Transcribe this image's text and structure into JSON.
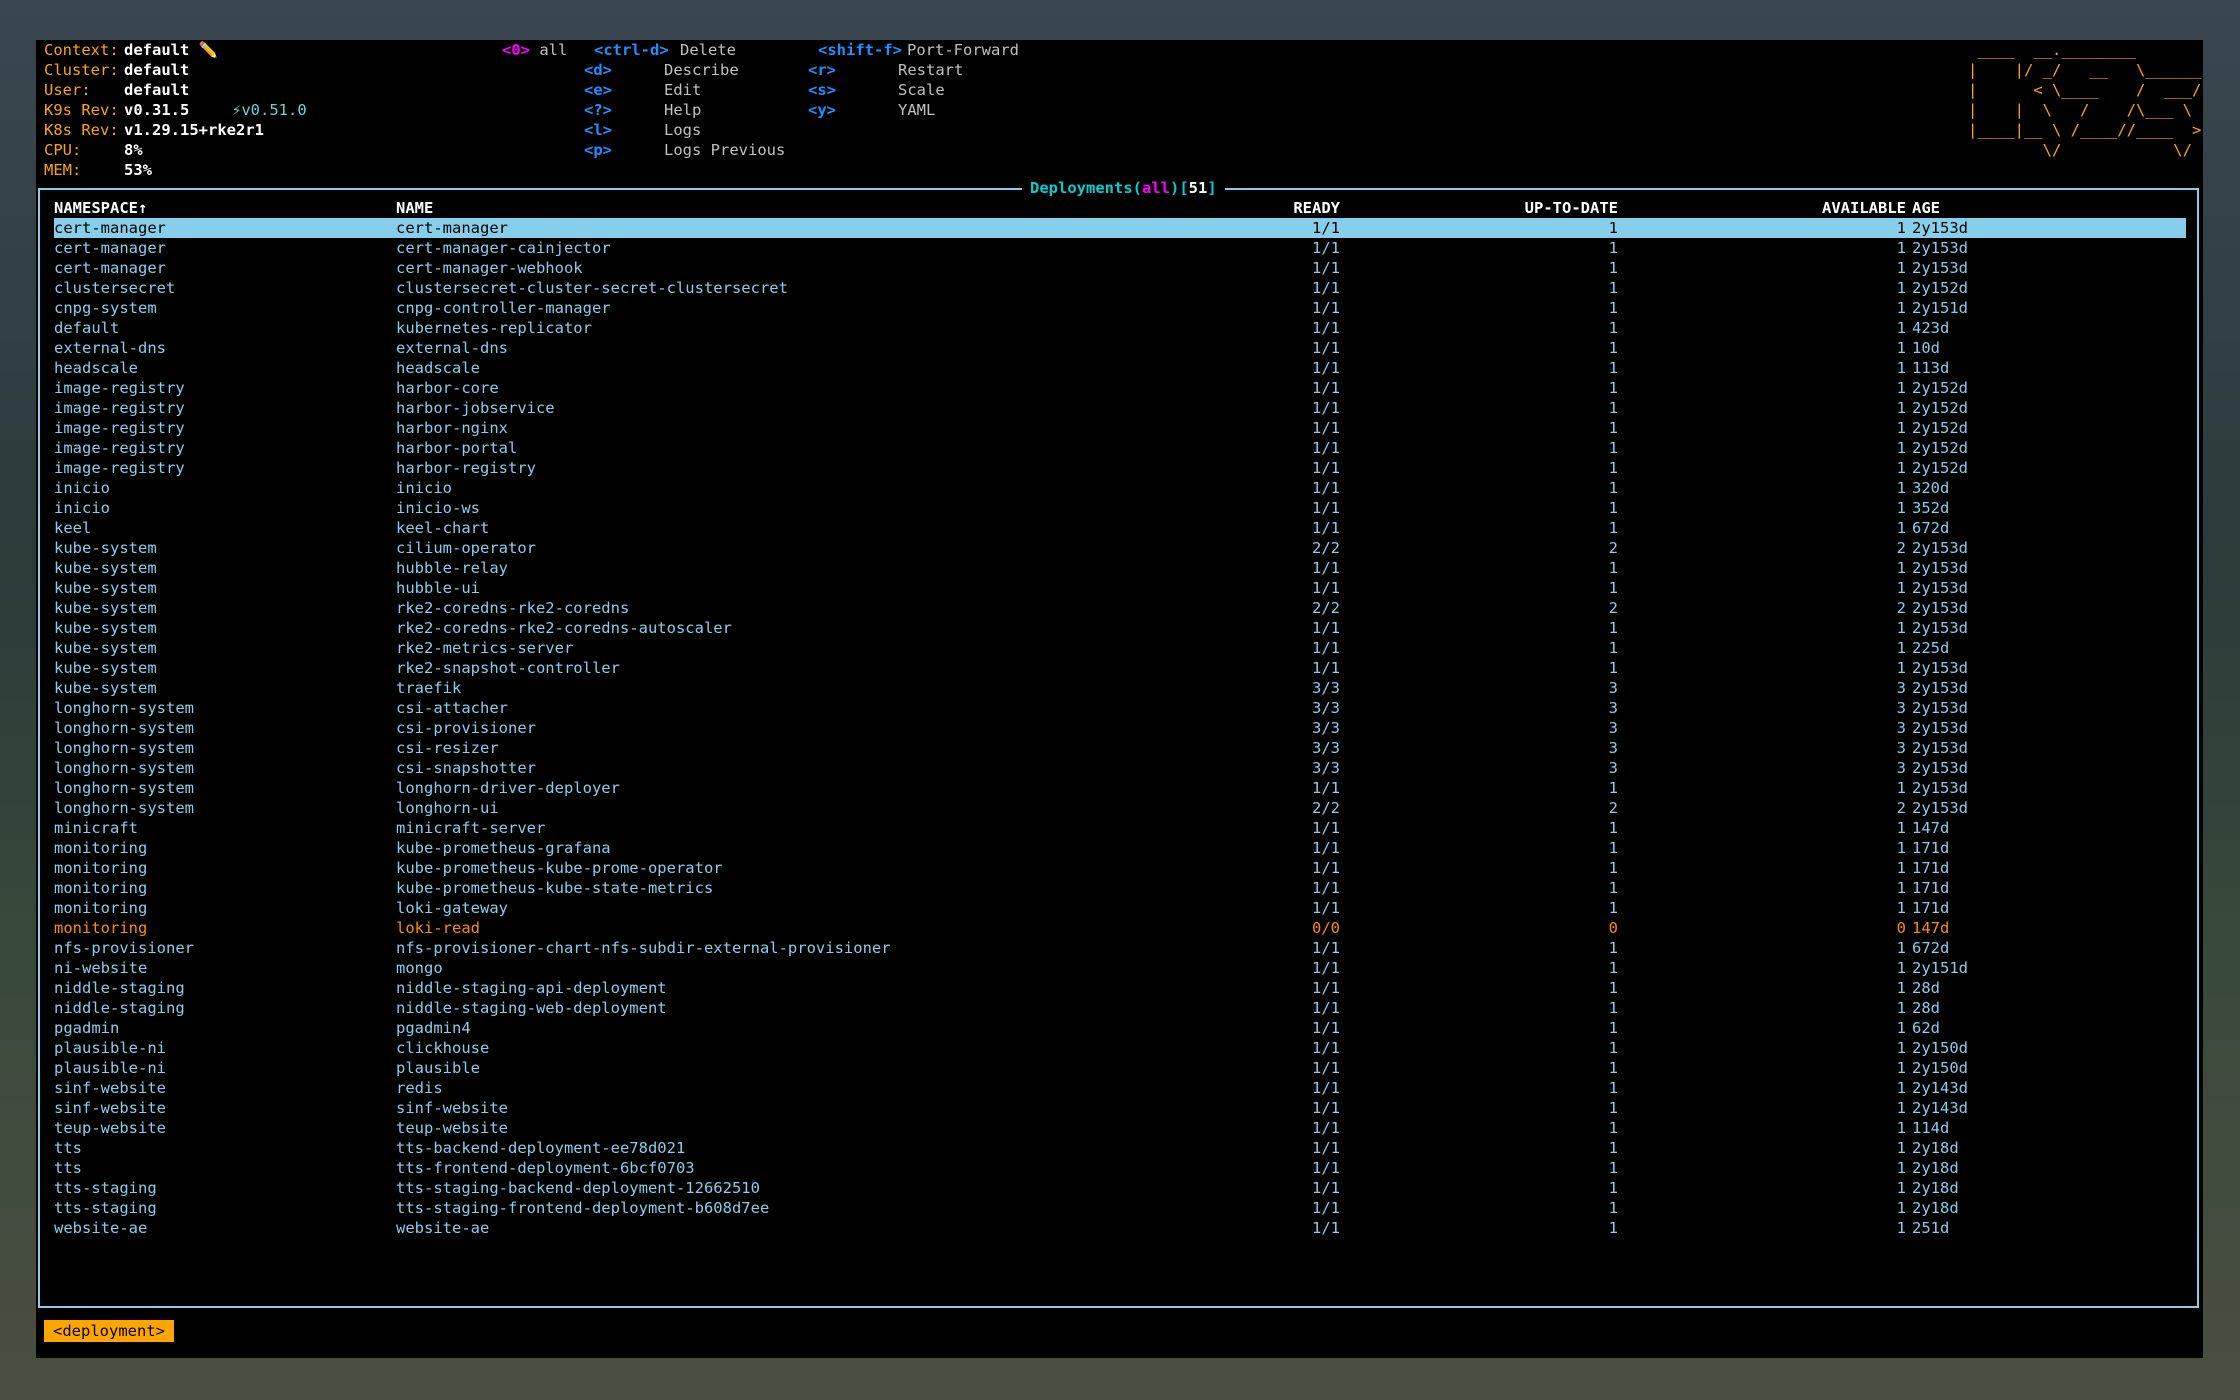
{
  "info": [
    {
      "label": "Context:",
      "value": "default ✏️"
    },
    {
      "label": "Cluster:",
      "value": "default"
    },
    {
      "label": "User:",
      "value": "default"
    },
    {
      "label": "K9s Rev:",
      "value": "v0.31.5",
      "extra": "⚡v0.51.0"
    },
    {
      "label": "K8s Rev:",
      "value": "v1.29.15+rke2r1"
    },
    {
      "label": "CPU:",
      "value": "8%"
    },
    {
      "label": "MEM:",
      "value": "53%"
    }
  ],
  "namespace_hotkey": {
    "key": "<0>",
    "label": "all"
  },
  "hotkeys": [
    {
      "key": "<ctrl-d>",
      "label": "Delete"
    },
    {
      "key": "<d>",
      "label": "Describe"
    },
    {
      "key": "<e>",
      "label": "Edit"
    },
    {
      "key": "<?>",
      "label": "Help"
    },
    {
      "key": "<l>",
      "label": "Logs"
    },
    {
      "key": "<p>",
      "label": "Logs Previous"
    },
    {
      "key": "<shift-f>",
      "label": "Port-Forward"
    },
    {
      "key": "<r>",
      "label": "Restart"
    },
    {
      "key": "<s>",
      "label": "Scale"
    },
    {
      "key": "<y>",
      "label": "YAML"
    }
  ],
  "logo": " ____  __.________       \n|    |/ _/   __   \\______\n|      < \\____    /  ___/\n|    |  \\   /    /\\___ \\ \n|____|__ \\ /____//____  >\n        \\/            \\/ ",
  "table": {
    "title": "Deployments",
    "filter": "all",
    "count": "51",
    "columns": [
      "NAMESPACE↑",
      "NAME",
      "READY",
      "UP-TO-DATE",
      "AVAILABLE",
      "AGE"
    ],
    "selected_index": 0,
    "rows": [
      [
        "cert-manager",
        "cert-manager",
        "1/1",
        "1",
        "1",
        "2y153d"
      ],
      [
        "cert-manager",
        "cert-manager-cainjector",
        "1/1",
        "1",
        "1",
        "2y153d"
      ],
      [
        "cert-manager",
        "cert-manager-webhook",
        "1/1",
        "1",
        "1",
        "2y153d"
      ],
      [
        "clustersecret",
        "clustersecret-cluster-secret-clustersecret",
        "1/1",
        "1",
        "1",
        "2y152d"
      ],
      [
        "cnpg-system",
        "cnpg-controller-manager",
        "1/1",
        "1",
        "1",
        "2y151d"
      ],
      [
        "default",
        "kubernetes-replicator",
        "1/1",
        "1",
        "1",
        "423d"
      ],
      [
        "external-dns",
        "external-dns",
        "1/1",
        "1",
        "1",
        "10d"
      ],
      [
        "headscale",
        "headscale",
        "1/1",
        "1",
        "1",
        "113d"
      ],
      [
        "image-registry",
        "harbor-core",
        "1/1",
        "1",
        "1",
        "2y152d"
      ],
      [
        "image-registry",
        "harbor-jobservice",
        "1/1",
        "1",
        "1",
        "2y152d"
      ],
      [
        "image-registry",
        "harbor-nginx",
        "1/1",
        "1",
        "1",
        "2y152d"
      ],
      [
        "image-registry",
        "harbor-portal",
        "1/1",
        "1",
        "1",
        "2y152d"
      ],
      [
        "image-registry",
        "harbor-registry",
        "1/1",
        "1",
        "1",
        "2y152d"
      ],
      [
        "inicio",
        "inicio",
        "1/1",
        "1",
        "1",
        "320d"
      ],
      [
        "inicio",
        "inicio-ws",
        "1/1",
        "1",
        "1",
        "352d"
      ],
      [
        "keel",
        "keel-chart",
        "1/1",
        "1",
        "1",
        "672d"
      ],
      [
        "kube-system",
        "cilium-operator",
        "2/2",
        "2",
        "2",
        "2y153d"
      ],
      [
        "kube-system",
        "hubble-relay",
        "1/1",
        "1",
        "1",
        "2y153d"
      ],
      [
        "kube-system",
        "hubble-ui",
        "1/1",
        "1",
        "1",
        "2y153d"
      ],
      [
        "kube-system",
        "rke2-coredns-rke2-coredns",
        "2/2",
        "2",
        "2",
        "2y153d"
      ],
      [
        "kube-system",
        "rke2-coredns-rke2-coredns-autoscaler",
        "1/1",
        "1",
        "1",
        "2y153d"
      ],
      [
        "kube-system",
        "rke2-metrics-server",
        "1/1",
        "1",
        "1",
        "225d"
      ],
      [
        "kube-system",
        "rke2-snapshot-controller",
        "1/1",
        "1",
        "1",
        "2y153d"
      ],
      [
        "kube-system",
        "traefik",
        "3/3",
        "3",
        "3",
        "2y153d"
      ],
      [
        "longhorn-system",
        "csi-attacher",
        "3/3",
        "3",
        "3",
        "2y153d"
      ],
      [
        "longhorn-system",
        "csi-provisioner",
        "3/3",
        "3",
        "3",
        "2y153d"
      ],
      [
        "longhorn-system",
        "csi-resizer",
        "3/3",
        "3",
        "3",
        "2y153d"
      ],
      [
        "longhorn-system",
        "csi-snapshotter",
        "3/3",
        "3",
        "3",
        "2y153d"
      ],
      [
        "longhorn-system",
        "longhorn-driver-deployer",
        "1/1",
        "1",
        "1",
        "2y153d"
      ],
      [
        "longhorn-system",
        "longhorn-ui",
        "2/2",
        "2",
        "2",
        "2y153d"
      ],
      [
        "minicraft",
        "minicraft-server",
        "1/1",
        "1",
        "1",
        "147d"
      ],
      [
        "monitoring",
        "kube-prometheus-grafana",
        "1/1",
        "1",
        "1",
        "171d"
      ],
      [
        "monitoring",
        "kube-prometheus-kube-prome-operator",
        "1/1",
        "1",
        "1",
        "171d"
      ],
      [
        "monitoring",
        "kube-prometheus-kube-state-metrics",
        "1/1",
        "1",
        "1",
        "171d"
      ],
      [
        "monitoring",
        "loki-gateway",
        "1/1",
        "1",
        "1",
        "171d"
      ],
      [
        "monitoring",
        "loki-read",
        "0/0",
        "0",
        "0",
        "147d"
      ],
      [
        "nfs-provisioner",
        "nfs-provisioner-chart-nfs-subdir-external-provisioner",
        "1/1",
        "1",
        "1",
        "672d"
      ],
      [
        "ni-website",
        "mongo",
        "1/1",
        "1",
        "1",
        "2y151d"
      ],
      [
        "niddle-staging",
        "niddle-staging-api-deployment",
        "1/1",
        "1",
        "1",
        "28d"
      ],
      [
        "niddle-staging",
        "niddle-staging-web-deployment",
        "1/1",
        "1",
        "1",
        "28d"
      ],
      [
        "pgadmin",
        "pgadmin4",
        "1/1",
        "1",
        "1",
        "62d"
      ],
      [
        "plausible-ni",
        "clickhouse",
        "1/1",
        "1",
        "1",
        "2y150d"
      ],
      [
        "plausible-ni",
        "plausible",
        "1/1",
        "1",
        "1",
        "2y150d"
      ],
      [
        "sinf-website",
        "redis",
        "1/1",
        "1",
        "1",
        "2y143d"
      ],
      [
        "sinf-website",
        "sinf-website",
        "1/1",
        "1",
        "1",
        "2y143d"
      ],
      [
        "teup-website",
        "teup-website",
        "1/1",
        "1",
        "1",
        "114d"
      ],
      [
        "tts",
        "tts-backend-deployment-ee78d021",
        "1/1",
        "1",
        "1",
        "2y18d"
      ],
      [
        "tts",
        "tts-frontend-deployment-6bcf0703",
        "1/1",
        "1",
        "1",
        "2y18d"
      ],
      [
        "tts-staging",
        "tts-staging-backend-deployment-12662510",
        "1/1",
        "1",
        "1",
        "2y18d"
      ],
      [
        "tts-staging",
        "tts-staging-frontend-deployment-b608d7ee",
        "1/1",
        "1",
        "1",
        "2y18d"
      ],
      [
        "website-ae",
        "website-ae",
        "1/1",
        "1",
        "1",
        "251d"
      ]
    ]
  },
  "breadcrumb": "<deployment>",
  "colors": {
    "accent": "#ffa500",
    "frame": "#87ceeb",
    "row_text": "#87ceeb",
    "warn": "#ff8c00",
    "key": "#1e90ff",
    "namespace_key": "#ff00ff"
  }
}
